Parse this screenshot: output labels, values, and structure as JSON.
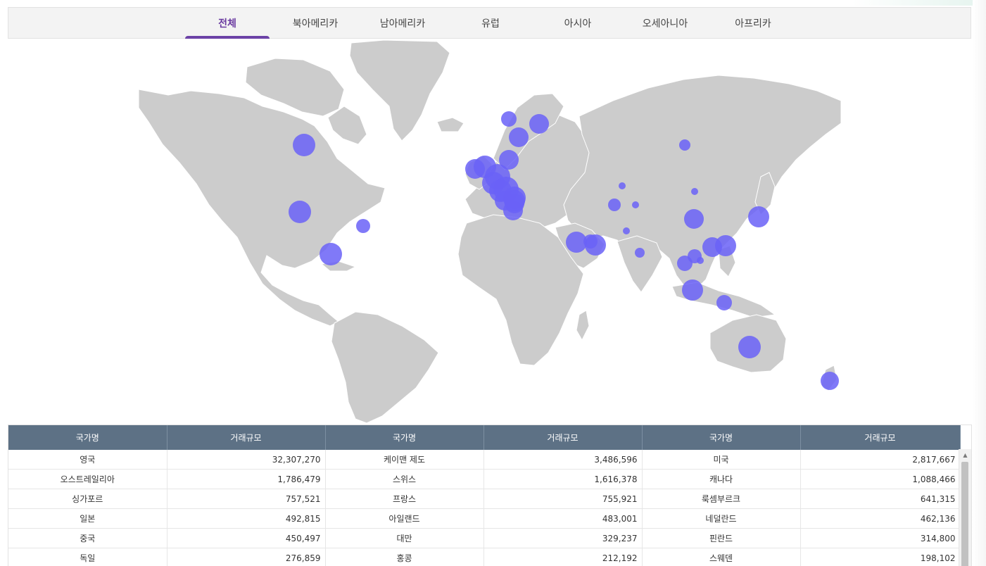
{
  "tabs": [
    {
      "label": "전체",
      "active": true
    },
    {
      "label": "북아메리카",
      "active": false
    },
    {
      "label": "남아메리카",
      "active": false
    },
    {
      "label": "유럽",
      "active": false
    },
    {
      "label": "아시아",
      "active": false
    },
    {
      "label": "오세아니아",
      "active": false
    },
    {
      "label": "아프리카",
      "active": false
    }
  ],
  "colors": {
    "accent": "#6c42a6",
    "bubble": "#6a62f7",
    "land": "#cccccc",
    "table_header": "#5d7185"
  },
  "table": {
    "headers": [
      "국가명",
      "거래규모",
      "국가명",
      "거래규모",
      "국가명",
      "거래규모"
    ],
    "rows": [
      [
        "영국",
        "32,307,270",
        "케이맨 제도",
        "3,486,596",
        "미국",
        "2,817,667"
      ],
      [
        "오스트레일리아",
        "1,786,479",
        "스위스",
        "1,616,378",
        "캐나다",
        "1,088,466"
      ],
      [
        "싱가포르",
        "757,521",
        "프랑스",
        "755,921",
        "룩셈부르크",
        "641,315"
      ],
      [
        "일본",
        "492,815",
        "아일랜드",
        "483,001",
        "네덜란드",
        "462,136"
      ],
      [
        "중국",
        "450,497",
        "대만",
        "329,237",
        "핀란드",
        "314,800"
      ],
      [
        "독일",
        "276,859",
        "홍콩",
        "212,192",
        "스웨덴",
        "198,102"
      ]
    ]
  },
  "scroll_icons": {
    "up": "scroll-up-arrow-icon"
  }
}
